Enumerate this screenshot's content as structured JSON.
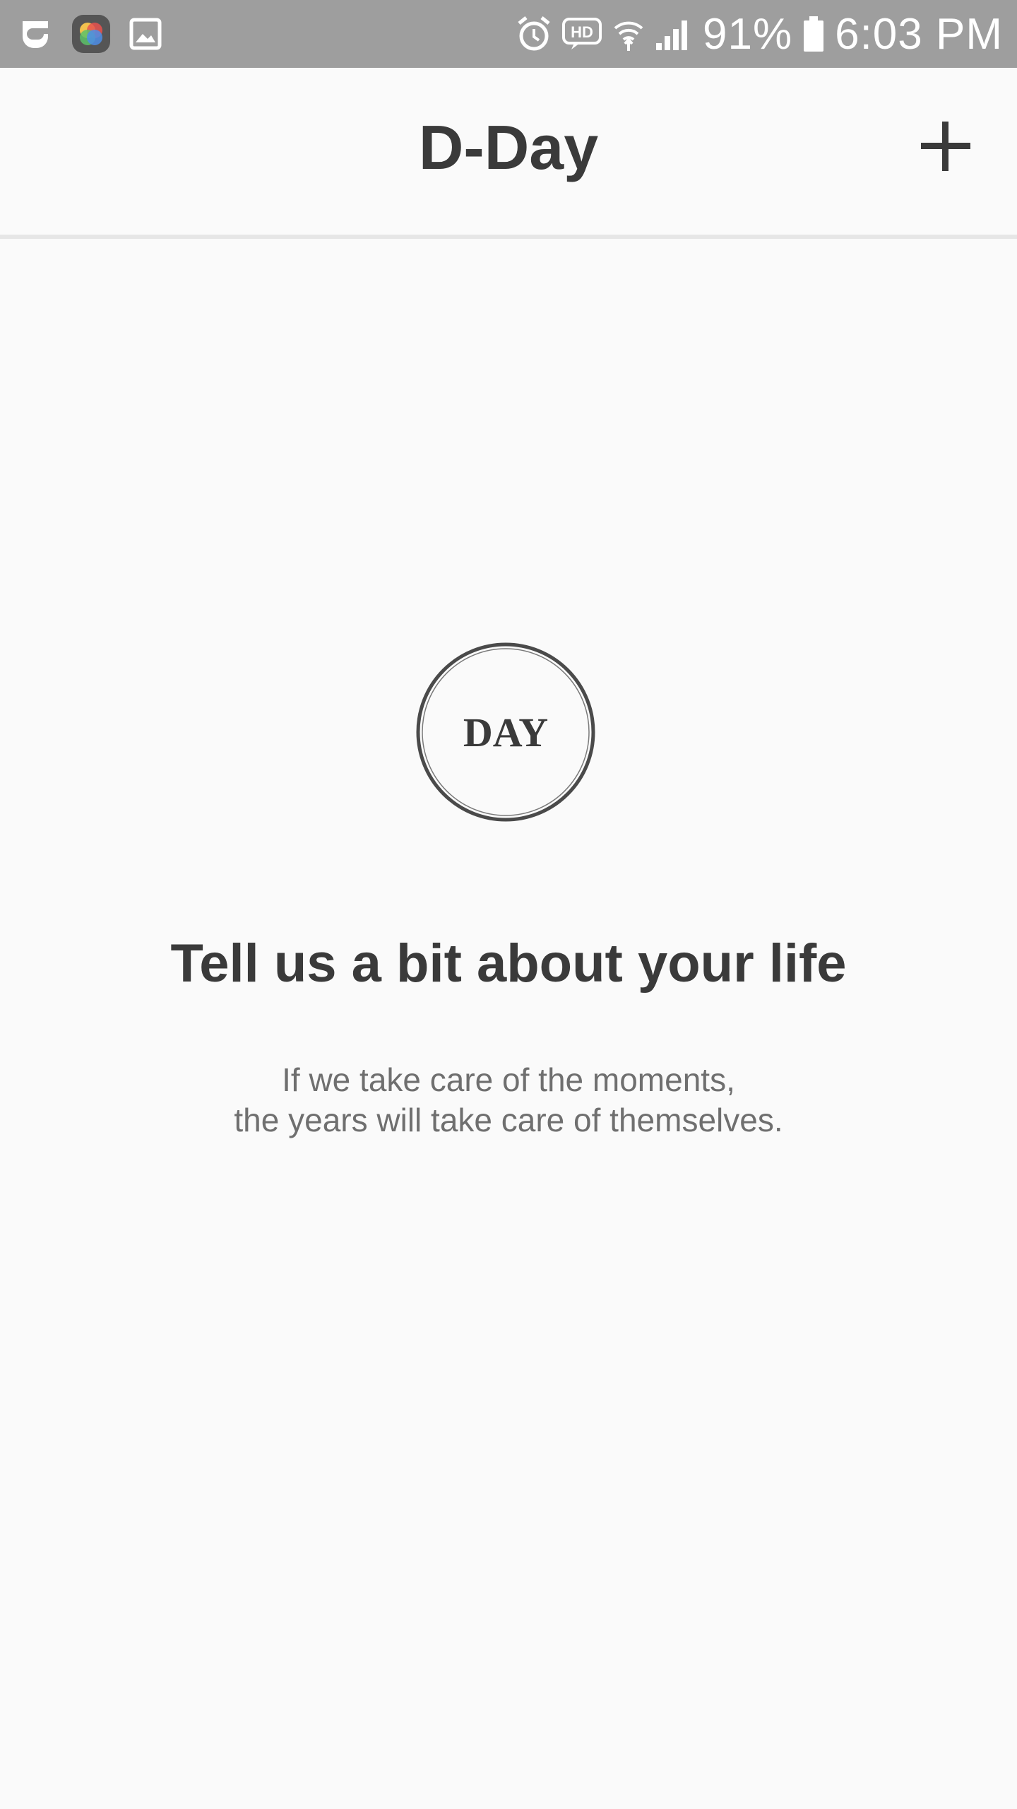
{
  "status_bar": {
    "left_icons": [
      "notification-app-icon",
      "color-app-icon",
      "gallery-icon"
    ],
    "right_icons": [
      "alarm-icon",
      "hd-voice-icon",
      "wifi-icon",
      "signal-icon",
      "battery-icon"
    ],
    "battery": "91%",
    "time": "6:03 PM",
    "background_color": "#9e9e9e"
  },
  "header": {
    "title": "D-Day",
    "add_icon": "plus-icon"
  },
  "empty_state": {
    "badge_text": "DAY",
    "headline": "Tell us a bit about your life",
    "subtitle_line1": "If we take care of the moments,",
    "subtitle_line2": "the years will take care of themselves."
  },
  "colors": {
    "background": "#fafafa",
    "title_text": "#3a3a3a",
    "subtitle_text": "#6f6f6f",
    "divider": "#e6e6e6"
  }
}
